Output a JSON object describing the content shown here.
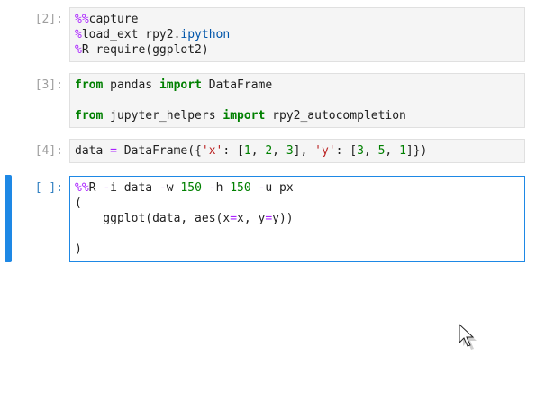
{
  "cells": [
    {
      "prompt": "[2]:",
      "lines": [
        [
          {
            "t": "%%",
            "c": "magic"
          },
          {
            "t": "capture",
            "c": ""
          }
        ],
        [
          {
            "t": "%",
            "c": "magic"
          },
          {
            "t": "load_ext rpy2.",
            "c": ""
          },
          {
            "t": "ipython",
            "c": "mod"
          }
        ],
        [
          {
            "t": "%",
            "c": "magic"
          },
          {
            "t": "R require(ggplot2)",
            "c": ""
          }
        ]
      ]
    },
    {
      "prompt": "[3]:",
      "lines": [
        [
          {
            "t": "from",
            "c": "kw"
          },
          {
            "t": " pandas ",
            "c": ""
          },
          {
            "t": "import",
            "c": "kw"
          },
          {
            "t": " DataFrame",
            "c": ""
          }
        ],
        [],
        [
          {
            "t": "from",
            "c": "kw"
          },
          {
            "t": " jupyter_helpers ",
            "c": ""
          },
          {
            "t": "import",
            "c": "kw"
          },
          {
            "t": " rpy2_autocompletion",
            "c": ""
          }
        ]
      ]
    },
    {
      "prompt": "[4]:",
      "lines": [
        [
          {
            "t": "data ",
            "c": ""
          },
          {
            "t": "=",
            "c": "op"
          },
          {
            "t": " DataFrame({",
            "c": ""
          },
          {
            "t": "'x'",
            "c": "str"
          },
          {
            "t": ": [",
            "c": ""
          },
          {
            "t": "1",
            "c": "num"
          },
          {
            "t": ", ",
            "c": ""
          },
          {
            "t": "2",
            "c": "num"
          },
          {
            "t": ", ",
            "c": ""
          },
          {
            "t": "3",
            "c": "num"
          },
          {
            "t": "], ",
            "c": ""
          },
          {
            "t": "'y'",
            "c": "str"
          },
          {
            "t": ": [",
            "c": ""
          },
          {
            "t": "3",
            "c": "num"
          },
          {
            "t": ", ",
            "c": ""
          },
          {
            "t": "5",
            "c": "num"
          },
          {
            "t": ", ",
            "c": ""
          },
          {
            "t": "1",
            "c": "num"
          },
          {
            "t": "]})",
            "c": ""
          }
        ]
      ]
    },
    {
      "prompt": "[ ]:",
      "lines": [
        [
          {
            "t": "%%",
            "c": "magic"
          },
          {
            "t": "R ",
            "c": ""
          },
          {
            "t": "-",
            "c": "op"
          },
          {
            "t": "i data ",
            "c": ""
          },
          {
            "t": "-",
            "c": "op"
          },
          {
            "t": "w ",
            "c": ""
          },
          {
            "t": "150",
            "c": "num"
          },
          {
            "t": " ",
            "c": ""
          },
          {
            "t": "-",
            "c": "op"
          },
          {
            "t": "h ",
            "c": ""
          },
          {
            "t": "150",
            "c": "num"
          },
          {
            "t": " ",
            "c": ""
          },
          {
            "t": "-",
            "c": "op"
          },
          {
            "t": "u px",
            "c": ""
          }
        ],
        [
          {
            "t": "(",
            "c": ""
          }
        ],
        [
          {
            "t": "    ggplot(data, aes(x",
            "c": ""
          },
          {
            "t": "=",
            "c": "op"
          },
          {
            "t": "x, y",
            "c": ""
          },
          {
            "t": "=",
            "c": "op"
          },
          {
            "t": "y))",
            "c": ""
          }
        ],
        [],
        [
          {
            "t": ")",
            "c": ""
          }
        ]
      ]
    }
  ],
  "colors": {
    "accent": "#1e88e5",
    "magic": "#aa22ff",
    "keyword": "#008000",
    "string": "#ba2121",
    "number": "#008000",
    "prompt_inactive": "#9e9e9e",
    "prompt_active": "#307fc1"
  },
  "cursor_icon": "mouse-pointer-icon"
}
